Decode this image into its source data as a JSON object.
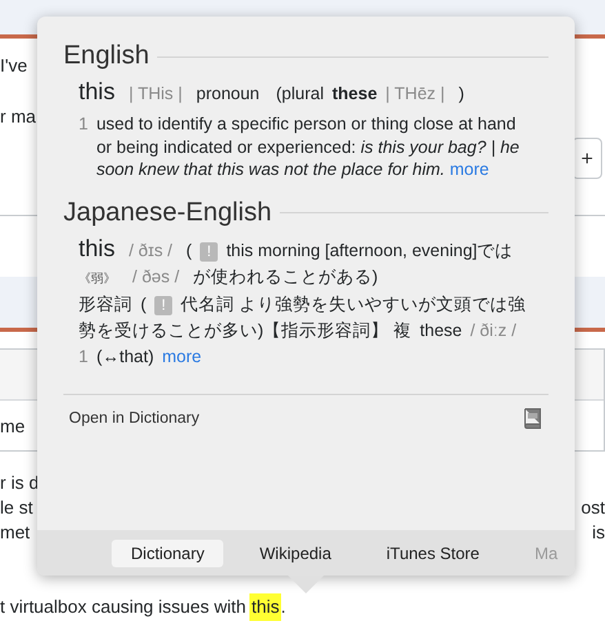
{
  "page": {
    "top_fragments": [
      "I've",
      "r ma"
    ],
    "plus_button": "+",
    "box_text": "me",
    "paragraph_lines": [
      {
        "left": "r is d"
      },
      {
        "left": "le st",
        "right": "ost"
      },
      {
        "left": "met",
        "right": "is"
      }
    ],
    "last_line": {
      "text": "t virtualbox causing issues with",
      "highlight": "this",
      "tail": "."
    }
  },
  "popup": {
    "sections": [
      {
        "title": "English",
        "lines": [
          [
            {
              "kind": "word",
              "text": "this"
            },
            {
              "kind": "pron",
              "text": "| THis |"
            },
            {
              "kind": "pos",
              "text": "pronoun"
            },
            {
              "kind": "text",
              "text": "(plural"
            },
            {
              "kind": "bold",
              "text": "these"
            },
            {
              "kind": "pron",
              "text": "| THēz |"
            },
            {
              "kind": "text",
              "text": ")"
            }
          ]
        ],
        "definitions": [
          {
            "num": "1",
            "text": "used to identify a specific person or thing close at hand or being indicated or experienced: *is this your bag? | he soon knew that this was not the place for him.*",
            "link": "more"
          }
        ]
      },
      {
        "title": "Japanese-English",
        "lines": [
          [
            {
              "kind": "word",
              "text": "this"
            },
            {
              "kind": "pron",
              "text": "/ ðɪs /"
            },
            {
              "kind": "text",
              "text": "("
            },
            {
              "kind": "badge",
              "text": "!"
            },
            {
              "kind": "text",
              "text": "this morning [afternoon, evening]では"
            }
          ],
          [
            {
              "kind": "small",
              "text": "《弱》"
            },
            {
              "kind": "pron",
              "text": "/ ðəs /"
            },
            {
              "kind": "text",
              "text": "が使われることがある)"
            }
          ],
          [
            {
              "kind": "text",
              "text": "形容詞"
            },
            {
              "kind": "text",
              "text": "("
            },
            {
              "kind": "badge",
              "text": "!"
            },
            {
              "kind": "text",
              "text": "代名詞 より強勢を失いやすいが文頭では強"
            }
          ],
          [
            {
              "kind": "text",
              "text": "勢を受けることが多い)【指示形容詞】 複"
            },
            {
              "kind": "text",
              "text": "these"
            },
            {
              "kind": "pron",
              "text": "/ ðiːz /"
            }
          ],
          [
            {
              "kind": "num",
              "text": "1"
            },
            {
              "kind": "text",
              "text": "(↔that)"
            },
            {
              "kind": "link",
              "text": "more"
            }
          ]
        ]
      }
    ],
    "open_link": "Open in Dictionary",
    "tabs": [
      {
        "label": "Dictionary",
        "selected": true,
        "cut": false
      },
      {
        "label": "Wikipedia",
        "selected": false,
        "cut": false
      },
      {
        "label": "iTunes Store",
        "selected": false,
        "cut": false
      },
      {
        "label": "Ma",
        "selected": false,
        "cut": true
      }
    ]
  }
}
